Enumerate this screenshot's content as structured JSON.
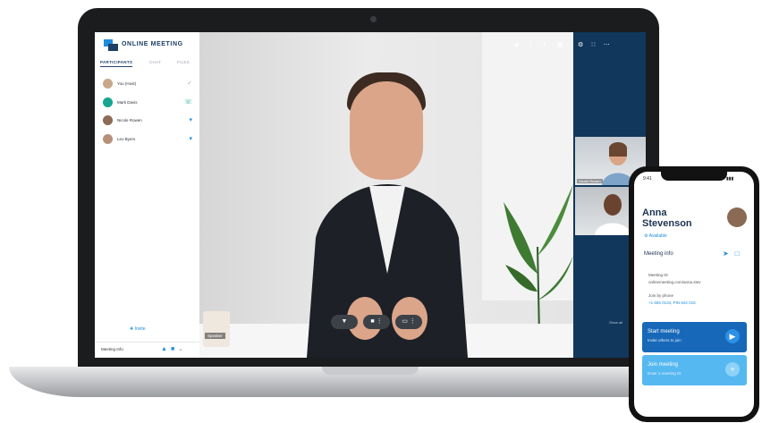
{
  "app": {
    "title": "ONLINE MEETING"
  },
  "sidebar": {
    "tabs": [
      {
        "label": "PARTICIPANTS",
        "active": true
      },
      {
        "label": "CHAT",
        "active": false
      },
      {
        "label": "FILES",
        "active": false
      }
    ],
    "participants": [
      {
        "name": "You (Host)",
        "status": "muted",
        "icon": "microphone-off-icon"
      },
      {
        "name": "Mark Davis",
        "status": "phone",
        "icon": "phone-icon"
      },
      {
        "name": "Nicole Rowen",
        "status": "speaking",
        "icon": "microphone-icon"
      },
      {
        "name": "Leo Byers",
        "status": "speaking",
        "icon": "microphone-icon"
      }
    ],
    "invite_label": "Invite",
    "footer_label": "Meeting Info"
  },
  "main": {
    "speaker_label": "Speaker",
    "top_controls": [
      "wifi-icon",
      "microphone-icon",
      "share-icon",
      "document-icon"
    ],
    "bottom_controls": [
      "microphone-icon",
      "camera-icon",
      "screen-share-icon"
    ]
  },
  "right_panel": {
    "controls": [
      "settings-icon",
      "grid-icon",
      "more-icon"
    ],
    "thumbnails": [
      {
        "label": "Nicole Rowen"
      },
      {
        "label": ""
      }
    ],
    "note": "Show all"
  },
  "phone": {
    "status_time": "9:41",
    "status_icons": "▮▮▮",
    "user_name_first": "Anna",
    "user_name_last": "Stevenson",
    "user_status": "Available",
    "meeting_info_label": "Meeting info",
    "info_lines": [
      "Meeting ID",
      "onlinemeeting.com/anna.stev",
      "Join by phone",
      "+1 555 0134, PIN 842 015"
    ],
    "start_card": {
      "title": "Start meeting",
      "subtitle": "Invite others to join"
    },
    "join_card": {
      "title": "Join meeting",
      "subtitle": "Enter a meeting ID"
    }
  },
  "colors": {
    "brand": "#1c3f66",
    "accent": "#1c8ee0",
    "panel": "#11375c",
    "teal": "#15a58f"
  }
}
